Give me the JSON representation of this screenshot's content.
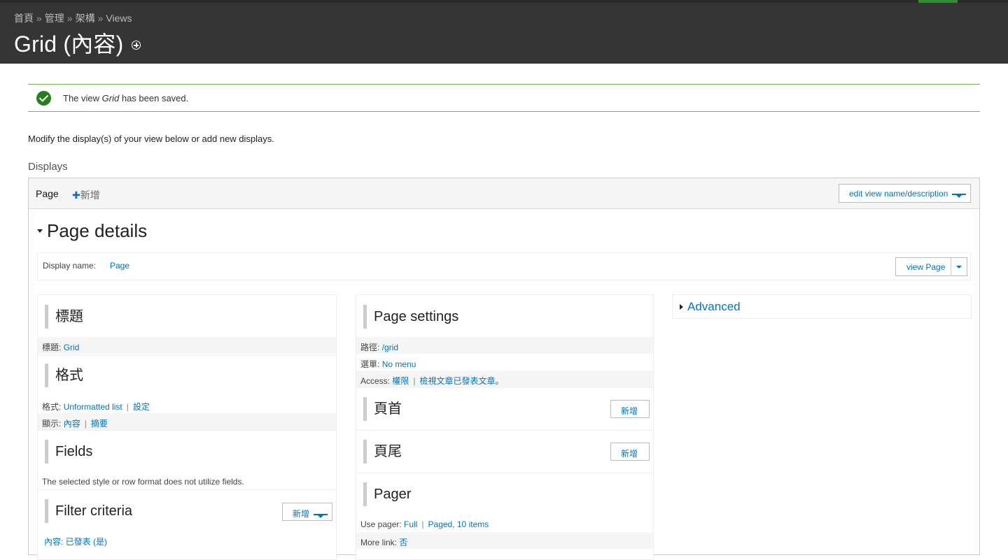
{
  "breadcrumb": [
    "首頁",
    "管理",
    "架構",
    "Views"
  ],
  "breadcrumb_sep": "»",
  "page_title": "Grid (內容)",
  "message": {
    "prefix": "The view",
    "name": "Grid",
    "suffix": "has been saved."
  },
  "intro": "Modify the display(s) of your view below or add new displays.",
  "displays_label": "Displays",
  "tabs": {
    "active": "Page",
    "add": "新增",
    "add_plus": "✚"
  },
  "edit_btn": "edit view name/description",
  "details_title": "Page details",
  "display_name": {
    "label": "Display name:",
    "value": "Page"
  },
  "view_btn": "view Page",
  "col1": {
    "title_sec": {
      "heading": "標題",
      "label": "標題:",
      "value": "Grid"
    },
    "format_sec": {
      "heading": "格式",
      "row1_label": "格式:",
      "row1_value": "Unformatted list",
      "row1_link2": "設定",
      "row2_label": "顯示:",
      "row2_value": "內容",
      "row2_link2": "摘要"
    },
    "fields_sec": {
      "heading": "Fields",
      "note": "The selected style or row format does not utilize fields."
    },
    "filter_sec": {
      "heading": "Filter criteria",
      "btn": "新增",
      "row": "內容: 已發表 (是)"
    }
  },
  "col2": {
    "page_settings": {
      "heading": "Page settings",
      "path_label": "路徑:",
      "path_value": "/grid",
      "menu_label": "選單:",
      "menu_value": "No menu",
      "access_label": "Access:",
      "access_value1": "權限",
      "access_value2": "檢視文章已發表文章。"
    },
    "header_sec": {
      "heading": "頁首",
      "btn": "新增"
    },
    "footer_sec": {
      "heading": "頁尾",
      "btn": "新增"
    },
    "pager_sec": {
      "heading": "Pager",
      "use_label": "Use pager:",
      "use_value1": "Full",
      "use_value2": "Paged, 10 items",
      "more_label": "More link:",
      "more_value": "否"
    }
  },
  "col3": {
    "advanced": "Advanced"
  },
  "colors": {
    "header_bg": "#353535",
    "link": "#0074bd",
    "success": "#2a7c22",
    "message_border": "#77b259"
  }
}
